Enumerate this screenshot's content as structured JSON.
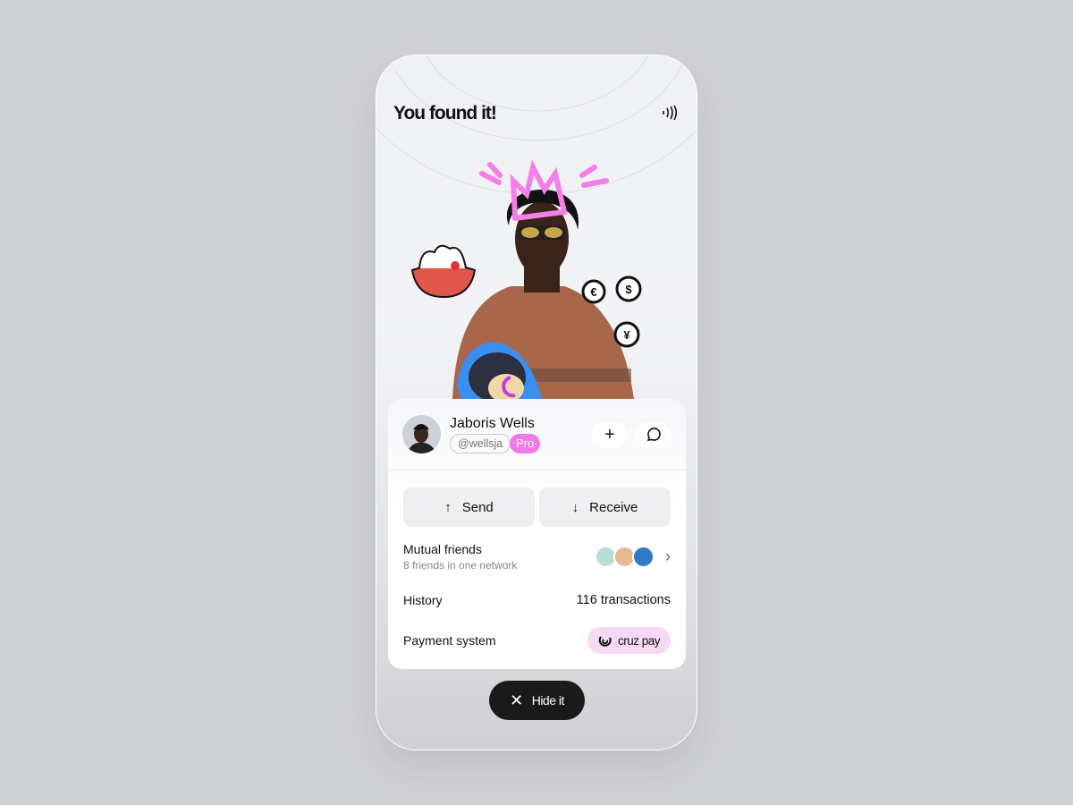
{
  "header": {
    "title": "You found it!",
    "nfc_icon": "contactless-icon"
  },
  "profile": {
    "name": "Jaboris Wells",
    "handle": "@wellsja",
    "badge": "Pro"
  },
  "actions": {
    "send": "Send",
    "receive": "Receive"
  },
  "mutual": {
    "label": "Mutual friends",
    "subtitle": "8 friends in one network"
  },
  "history": {
    "label": "History",
    "value": "116 transactions"
  },
  "payment": {
    "label": "Payment system",
    "provider": "cruz pay"
  },
  "hide_button": "Hide it",
  "colors": {
    "accent_pink": "#f07ae6",
    "cruz_bg": "#f7d8f5",
    "dark": "#1a1a1a"
  }
}
